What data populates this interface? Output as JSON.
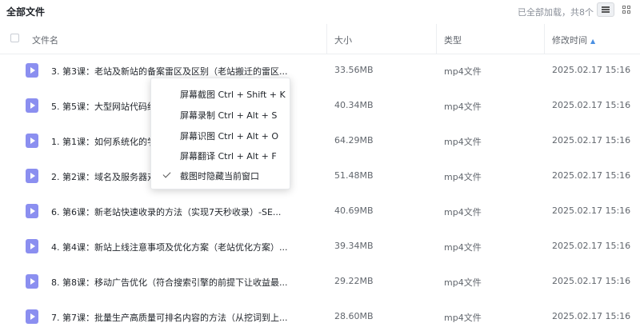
{
  "header": {
    "title": "全部文件",
    "status": "已全部加载，共8个"
  },
  "columns": {
    "name": "文件名",
    "size": "大小",
    "type": "类型",
    "modified": "修改时间"
  },
  "files": [
    {
      "name": "3. 第3课：老站及新站的备案雷区及区别（老站搬迁的雷区...",
      "size": "33.56MB",
      "type": "mp4文件",
      "modified": "2025.02.17 15:16"
    },
    {
      "name": "5. 第5课：大型网站代码细节优化",
      "size": "40.34MB",
      "type": "mp4文件",
      "modified": "2025.02.17 15:16"
    },
    {
      "name": "1. 第1课：如何系统化的学习SEO",
      "size": "64.29MB",
      "type": "mp4文件",
      "modified": "2025.02.17 15:16"
    },
    {
      "name": "2. 第2课：域名及服务器对",
      "size": "51.48MB",
      "type": "mp4文件",
      "modified": "2025.02.17 15:16"
    },
    {
      "name": "6. 第6课：新老站快速收录的方法（实现7天秒收录）-SE...",
      "size": "40.69MB",
      "type": "mp4文件",
      "modified": "2025.02.17 15:16"
    },
    {
      "name": "4. 第4课：新站上线注意事项及优化方案（老站优化方案）...",
      "size": "39.34MB",
      "type": "mp4文件",
      "modified": "2025.02.17 15:16"
    },
    {
      "name": "8. 第8课：移动广告优化（符合搜索引擎的前提下让收益最...",
      "size": "29.22MB",
      "type": "mp4文件",
      "modified": "2025.02.17 15:16"
    },
    {
      "name": "7. 第7课：批量生产高质量可排名内容的方法（从挖词到上...",
      "size": "28.60MB",
      "type": "mp4文件",
      "modified": "2025.02.17 15:16"
    }
  ],
  "context_menu": {
    "items": [
      "屏幕截图 Ctrl + Shift + K",
      "屏幕录制 Ctrl + Alt + S",
      "屏幕识图 Ctrl + Alt + O",
      "屏幕翻译 Ctrl + Alt + F",
      "截图时隐藏当前窗口"
    ]
  }
}
